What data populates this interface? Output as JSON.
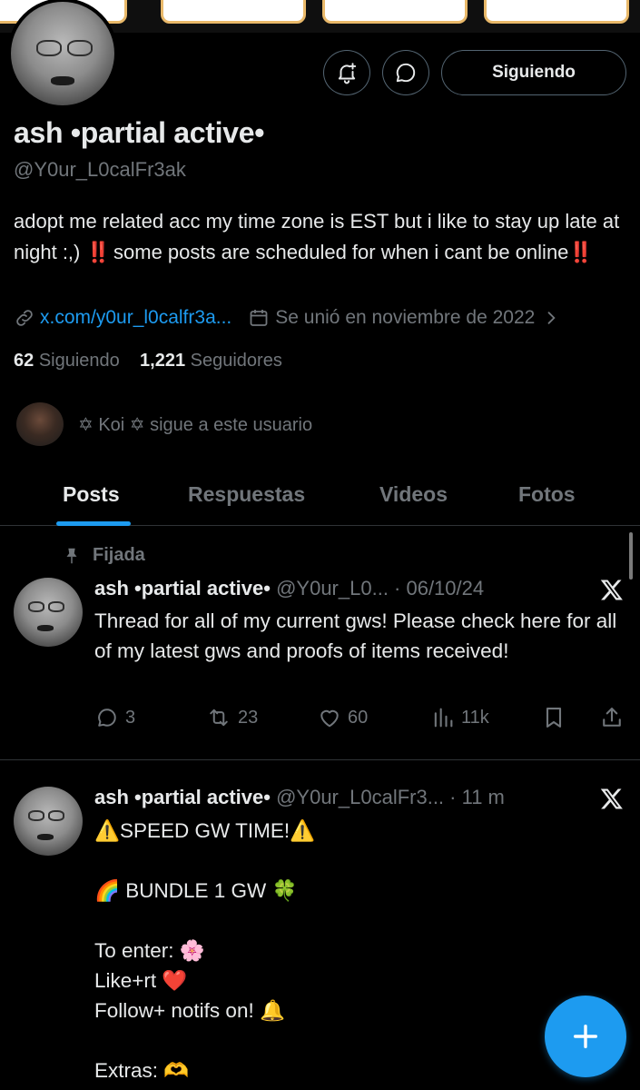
{
  "profile": {
    "name": "ash •partial active•",
    "handle": "@Y0ur_L0calFr3ak",
    "bio_part1": "adopt me related acc my time zone is EST but i like to stay up late at night :,) ",
    "bio_bang1": "‼️",
    "bio_part2": " some posts are scheduled for when i cant be online",
    "bio_bang2": "‼️",
    "link": "x.com/y0ur_l0calfr3a...",
    "joined": "Se unió en noviembre de 2022",
    "following_count": "62",
    "following_label": "Siguiendo",
    "followers_count": "1,221",
    "followers_label": "Seguidores",
    "followed_by": "✡ Koi ✡ sigue a este usuario"
  },
  "buttons": {
    "follow_label": "Siguiendo",
    "notifications_icon": "bell-plus-icon",
    "message_icon": "message-bubble-icon"
  },
  "tabs": [
    {
      "label": "Posts",
      "active": true
    },
    {
      "label": "Respuestas",
      "active": false
    },
    {
      "label": "Videos",
      "active": false
    },
    {
      "label": "Fotos",
      "active": false
    }
  ],
  "posts": [
    {
      "pinned_label": "Fijada",
      "name": "ash •partial active•",
      "handle_time": "@Y0ur_L0... · 06/10/24",
      "text": "Thread for all of my current gws! Please check here for all of my latest gws and proofs of items received!",
      "replies": "3",
      "reposts": "23",
      "likes": "60",
      "views": "11k"
    },
    {
      "name": "ash •partial active•",
      "handle_time": "@Y0ur_L0calFr3... · 11 m",
      "lines": [
        "⚠️SPEED GW TIME!⚠️",
        "",
        "🌈 BUNDLE 1 GW 🍀",
        "",
        "To enter: 🌸",
        "Like+rt ❤️",
        "Follow+ notifs on! 🔔",
        "",
        "Extras: 🫶"
      ]
    }
  ],
  "colors": {
    "accent": "#1d9bf0",
    "muted": "#71767b",
    "border": "#2f3336",
    "background": "#000000"
  }
}
